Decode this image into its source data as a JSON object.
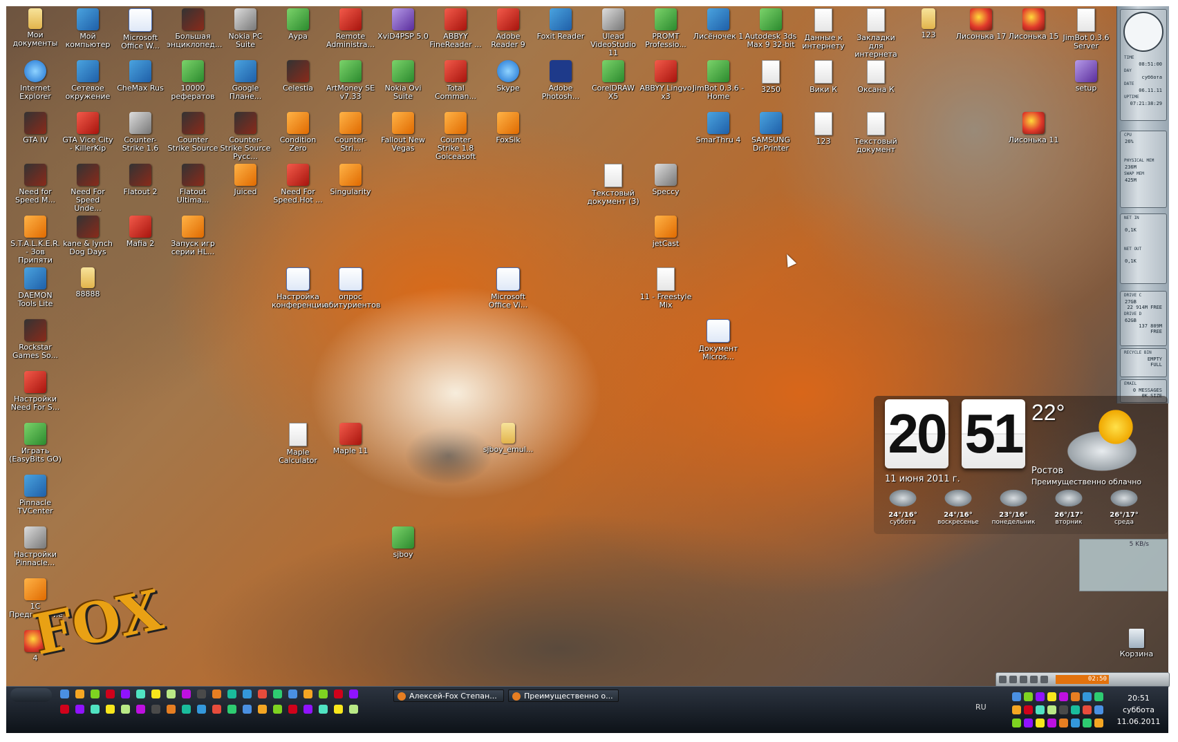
{
  "desktop": {
    "icons": [
      {
        "label": "Мои документы",
        "kind": "folder"
      },
      {
        "label": "Мой компьютер",
        "kind": "exe"
      },
      {
        "label": "Microsoft Office W...",
        "kind": "word"
      },
      {
        "label": "Большая энциклопед...",
        "kind": "game"
      },
      {
        "label": "Nokia PC Suite",
        "kind": "gray"
      },
      {
        "label": "Аура",
        "kind": "green"
      },
      {
        "label": "Remote Administra...",
        "kind": "red"
      },
      {
        "label": "XviD4PSP 5.0",
        "kind": "purple"
      },
      {
        "label": "ABBYY FineReader ...",
        "kind": "red"
      },
      {
        "label": "Adobe Reader 9",
        "kind": "red"
      },
      {
        "label": "Foxit Reader",
        "kind": "exe"
      },
      {
        "label": "Ulead VideoStudio 11",
        "kind": "gray"
      },
      {
        "label": "PROMT Professio...",
        "kind": "green"
      },
      {
        "label": "Лисёночек 1",
        "kind": "exe"
      },
      {
        "label": "Autodesk 3ds Max 9 32-bit",
        "kind": "green"
      },
      {
        "label": "Данные к интернету",
        "kind": "doc"
      },
      {
        "label": "Закладки для интернета",
        "kind": "doc"
      },
      {
        "label": "123",
        "kind": "folder"
      },
      {
        "label": "Лисонька 17",
        "kind": "pic"
      },
      {
        "label": "Лисонька 15",
        "kind": "pic"
      },
      {
        "label": "JimBot 0.3.6 Server",
        "kind": "doc"
      },
      {
        "label": "Internet Explorer",
        "kind": "ie"
      },
      {
        "label": "Сетевое окружение",
        "kind": "exe"
      },
      {
        "label": "CheMax Rus",
        "kind": "exe"
      },
      {
        "label": "10000 рефератов",
        "kind": "green"
      },
      {
        "label": "Google Плане...",
        "kind": "exe"
      },
      {
        "label": "Celestia",
        "kind": "game"
      },
      {
        "label": "ArtMoney SE v7.33",
        "kind": "green"
      },
      {
        "label": "Nokia Ovi Suite",
        "kind": "green"
      },
      {
        "label": "Total Comman...",
        "kind": "red"
      },
      {
        "label": "Skype",
        "kind": "ie"
      },
      {
        "label": "Adobe Photosh...",
        "kind": "ps"
      },
      {
        "label": "CorelDRAW X5",
        "kind": "green"
      },
      {
        "label": "ABBYY Lingvo x3",
        "kind": "red"
      },
      {
        "label": "JimBot 0.3.6 - Home",
        "kind": "green"
      },
      {
        "label": "3250",
        "kind": "doc"
      },
      {
        "label": "Вики К",
        "kind": "doc"
      },
      {
        "label": "Оксана К",
        "kind": "doc"
      },
      {
        "label": "setup",
        "kind": "purple"
      },
      {
        "label": "GTA IV",
        "kind": "game"
      },
      {
        "label": "GTA Vice City - KillerKip",
        "kind": "red"
      },
      {
        "label": "Counter-Strike 1.6",
        "kind": "gray"
      },
      {
        "label": "Counter Strike Source",
        "kind": "game"
      },
      {
        "label": "Counter-Strike Source Русс...",
        "kind": "game"
      },
      {
        "label": "Condition Zero",
        "kind": "orange"
      },
      {
        "label": "Counter-Stri...",
        "kind": "orange"
      },
      {
        "label": "Fallout New Vegas",
        "kind": "orange"
      },
      {
        "label": "Counter Strike 1.8 Goiceasoft",
        "kind": "orange"
      },
      {
        "label": "FoxSik",
        "kind": "orange"
      },
      {
        "label": "SmarThru 4",
        "kind": "exe"
      },
      {
        "label": "SAMSUNG Dr.Printer",
        "kind": "exe"
      },
      {
        "label": "123",
        "kind": "doc"
      },
      {
        "label": "Текстовый документ",
        "kind": "doc"
      },
      {
        "label": "Лисонька 11",
        "kind": "pic"
      },
      {
        "label": "Need for Speed M...",
        "kind": "game"
      },
      {
        "label": "Need For Speed Unde...",
        "kind": "game"
      },
      {
        "label": "Flatout 2",
        "kind": "game"
      },
      {
        "label": "Flatout Ultima...",
        "kind": "game"
      },
      {
        "label": "Juiced",
        "kind": "orange"
      },
      {
        "label": "Need For Speed.Hot ...",
        "kind": "red"
      },
      {
        "label": "Singularity",
        "kind": "orange"
      },
      {
        "label": "Текстовый документ (3)",
        "kind": "doc"
      },
      {
        "label": "Speccy",
        "kind": "gray"
      },
      {
        "label": "S.T.A.L.K.E.R. - Зов Припяти",
        "kind": "orange"
      },
      {
        "label": "kane & lynch Dog Days",
        "kind": "game"
      },
      {
        "label": "Mafia 2",
        "kind": "red"
      },
      {
        "label": "Запуск игр серии HL...",
        "kind": "orange"
      },
      {
        "label": "jetCast",
        "kind": "orange"
      },
      {
        "label": "DAEMON Tools Lite",
        "kind": "exe"
      },
      {
        "label": "88888",
        "kind": "folder"
      },
      {
        "label": "Настройка конференции",
        "kind": "word"
      },
      {
        "label": "опрос абитуриентов",
        "kind": "word"
      },
      {
        "label": "Microsoft Office Vi...",
        "kind": "word"
      },
      {
        "label": "11 - Freestyle Mix",
        "kind": "doc"
      },
      {
        "label": "Rockstar Games So...",
        "kind": "game"
      },
      {
        "label": "Документ Micros...",
        "kind": "word"
      },
      {
        "label": "Настройки Need For S...",
        "kind": "red"
      },
      {
        "label": "Играть (EasyBits GO)",
        "kind": "green"
      },
      {
        "label": "Maple Calculator",
        "kind": "doc"
      },
      {
        "label": "Maple 11",
        "kind": "red"
      },
      {
        "label": "sjboy_emul...",
        "kind": "folder"
      },
      {
        "label": "Pinnacle TVCenter",
        "kind": "exe"
      },
      {
        "label": "Настройки Pinnacle...",
        "kind": "gray"
      },
      {
        "label": "sjboy",
        "kind": "green"
      },
      {
        "label": "1С Предприятие",
        "kind": "orange"
      },
      {
        "label": "4",
        "kind": "pic"
      }
    ],
    "recycle_bin": "Корзина",
    "logo_text": "FOX"
  },
  "sidebar": {
    "time_label": "TIME",
    "time_value": "08:51:00",
    "day_label": "DAY",
    "day_value": "суббота",
    "date_label": "DATE",
    "date_value": "06.11.11",
    "uptime_label": "UPTIME",
    "uptime_value": "07:21:38:29",
    "cpu_label": "CPU",
    "cpu_value": "26%",
    "physmem_label": "PHYSICAL MEM",
    "physmem_value": "236M",
    "swapmem_label": "SWAP MEM",
    "swapmem_value": "425M",
    "netin_label": "NET IN",
    "netin_value": "0,1K",
    "netout_label": "NET OUT",
    "netout_value": "0,1K",
    "drivec_label": "DRIVE C",
    "drivec_value": "27GB",
    "drivec_free": "22 914M FREE",
    "drived_label": "DRIVE D",
    "drived_value": "62GB",
    "drived_free": "137 809M FREE",
    "recycle_label": "RECYCLE BIN",
    "recycle_empty": "EMPTY",
    "recycle_full": "FULL",
    "email_label": "EMAIL",
    "email_messages": "0 MESSAGES",
    "email_size": "0K SIZE"
  },
  "weather": {
    "hour": "20",
    "minute": "51",
    "temp": "22°",
    "date": "11 июня 2011 г.",
    "city": "Ростов",
    "condition": "Преимущественно облачно",
    "forecast": [
      {
        "temp": "24°/16°",
        "day": "суббота"
      },
      {
        "temp": "24°/16°",
        "day": "воскресенье"
      },
      {
        "temp": "23°/16°",
        "day": "понедельник"
      },
      {
        "temp": "26°/17°",
        "day": "вторник"
      },
      {
        "temp": "26°/17°",
        "day": "среда"
      }
    ]
  },
  "netwidget": {
    "rate": "5 KB/s"
  },
  "media": {
    "time": "02:50"
  },
  "taskbar": {
    "tasks": [
      "Алексей-Fox Степан...",
      "Преимущественно о..."
    ],
    "lang": "RU",
    "time": "20:51",
    "day": "суббота",
    "date": "11.06.2011"
  }
}
